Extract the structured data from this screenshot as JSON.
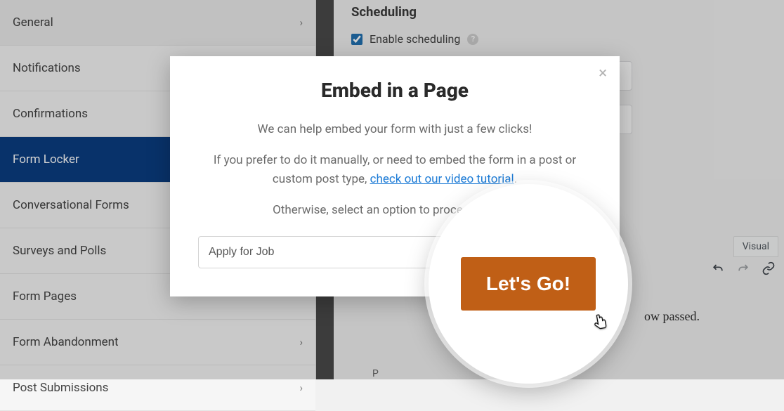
{
  "sidebar": {
    "items": [
      {
        "label": "General",
        "has_chevron": true
      },
      {
        "label": "Notifications",
        "has_chevron": false
      },
      {
        "label": "Confirmations",
        "has_chevron": false
      },
      {
        "label": "Form Locker",
        "has_chevron": true,
        "active": true
      },
      {
        "label": "Conversational Forms",
        "has_chevron": false
      },
      {
        "label": "Surveys and Polls",
        "has_chevron": false
      },
      {
        "label": "Form Pages",
        "has_chevron": false
      },
      {
        "label": "Form Abandonment",
        "has_chevron": true
      },
      {
        "label": "Post Submissions",
        "has_chevron": true
      }
    ]
  },
  "main": {
    "scheduling_heading": "Scheduling",
    "enable_label": "Enable scheduling",
    "visual_tab": "Visual",
    "passed_text": "ow passed.",
    "p_label": "P"
  },
  "modal": {
    "title": "Embed in a Page",
    "p1": "We can help embed your form with just a few clicks!",
    "p2_a": "If you prefer to do it manually, or need to embed the form in a post or custom post type, ",
    "p2_link": "check out our video tutorial",
    "p2_b": ".",
    "p3": "Otherwise, select an option to proceed wizard.",
    "input_value": "Apply for Job",
    "button_label": "Let's Go!"
  }
}
